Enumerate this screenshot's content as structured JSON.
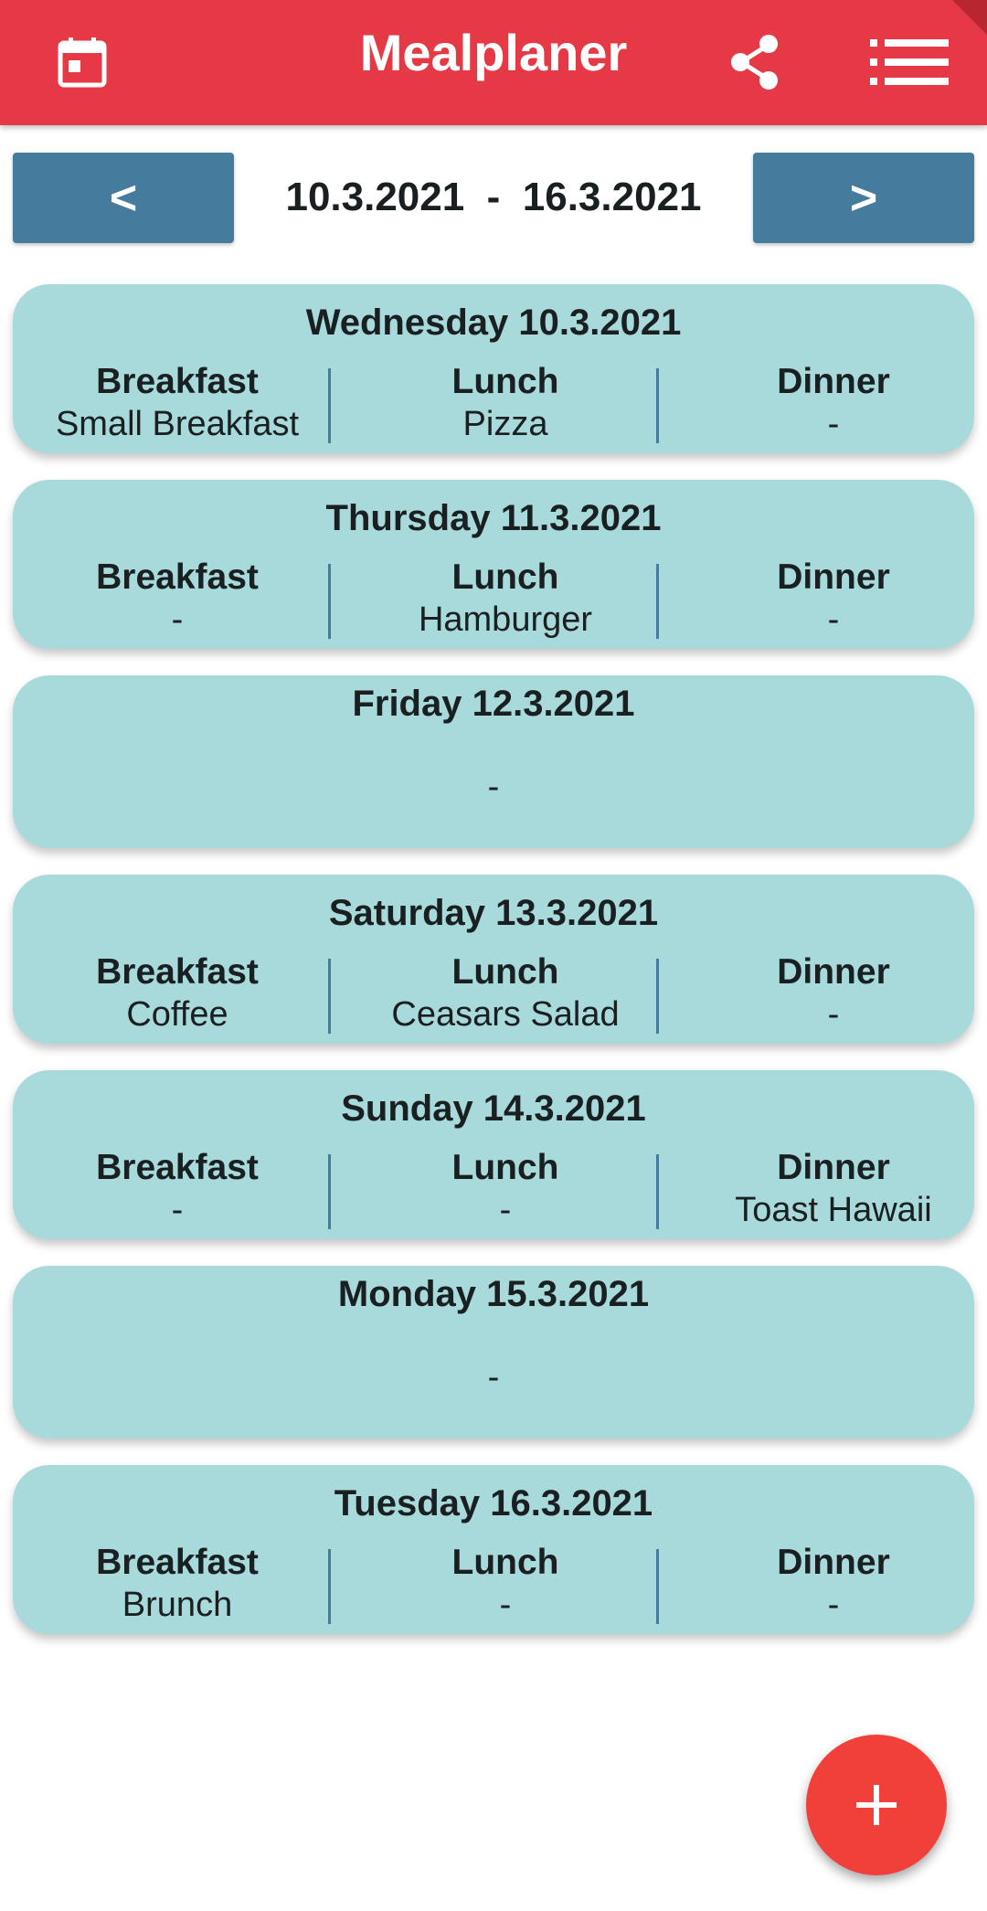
{
  "app": {
    "title": "Mealplaner",
    "accent_color": "#e63946",
    "nav_color": "#457b9d",
    "card_color": "#a8dadc",
    "fab_color": "#f1403a",
    "icons": [
      "calendar-icon",
      "share-icon",
      "list-icon",
      "plus-icon"
    ]
  },
  "week_nav": {
    "prev_label": "<",
    "next_label": ">",
    "range_text": "10.3.2021  -  16.3.2021"
  },
  "meal_labels": {
    "breakfast": "Breakfast",
    "lunch": "Lunch",
    "dinner": "Dinner"
  },
  "days": [
    {
      "title": "Wednesday 10.3.2021",
      "breakfast": "Small Breakfast",
      "lunch": "Pizza",
      "dinner": "-"
    },
    {
      "title": "Thursday 11.3.2021",
      "breakfast": "-",
      "lunch": "Hamburger",
      "dinner": "-"
    },
    {
      "title": "Friday 12.3.2021",
      "empty_text": "-"
    },
    {
      "title": "Saturday 13.3.2021",
      "breakfast": "Coffee",
      "lunch": "Ceasars Salad",
      "dinner": "-"
    },
    {
      "title": "Sunday 14.3.2021",
      "breakfast": "-",
      "lunch": "-",
      "dinner": "Toast Hawaii"
    },
    {
      "title": "Monday 15.3.2021",
      "empty_text": "-"
    },
    {
      "title": "Tuesday 16.3.2021",
      "breakfast": "Brunch",
      "lunch": "-",
      "dinner": "-"
    }
  ],
  "fab": {
    "label": "+"
  }
}
